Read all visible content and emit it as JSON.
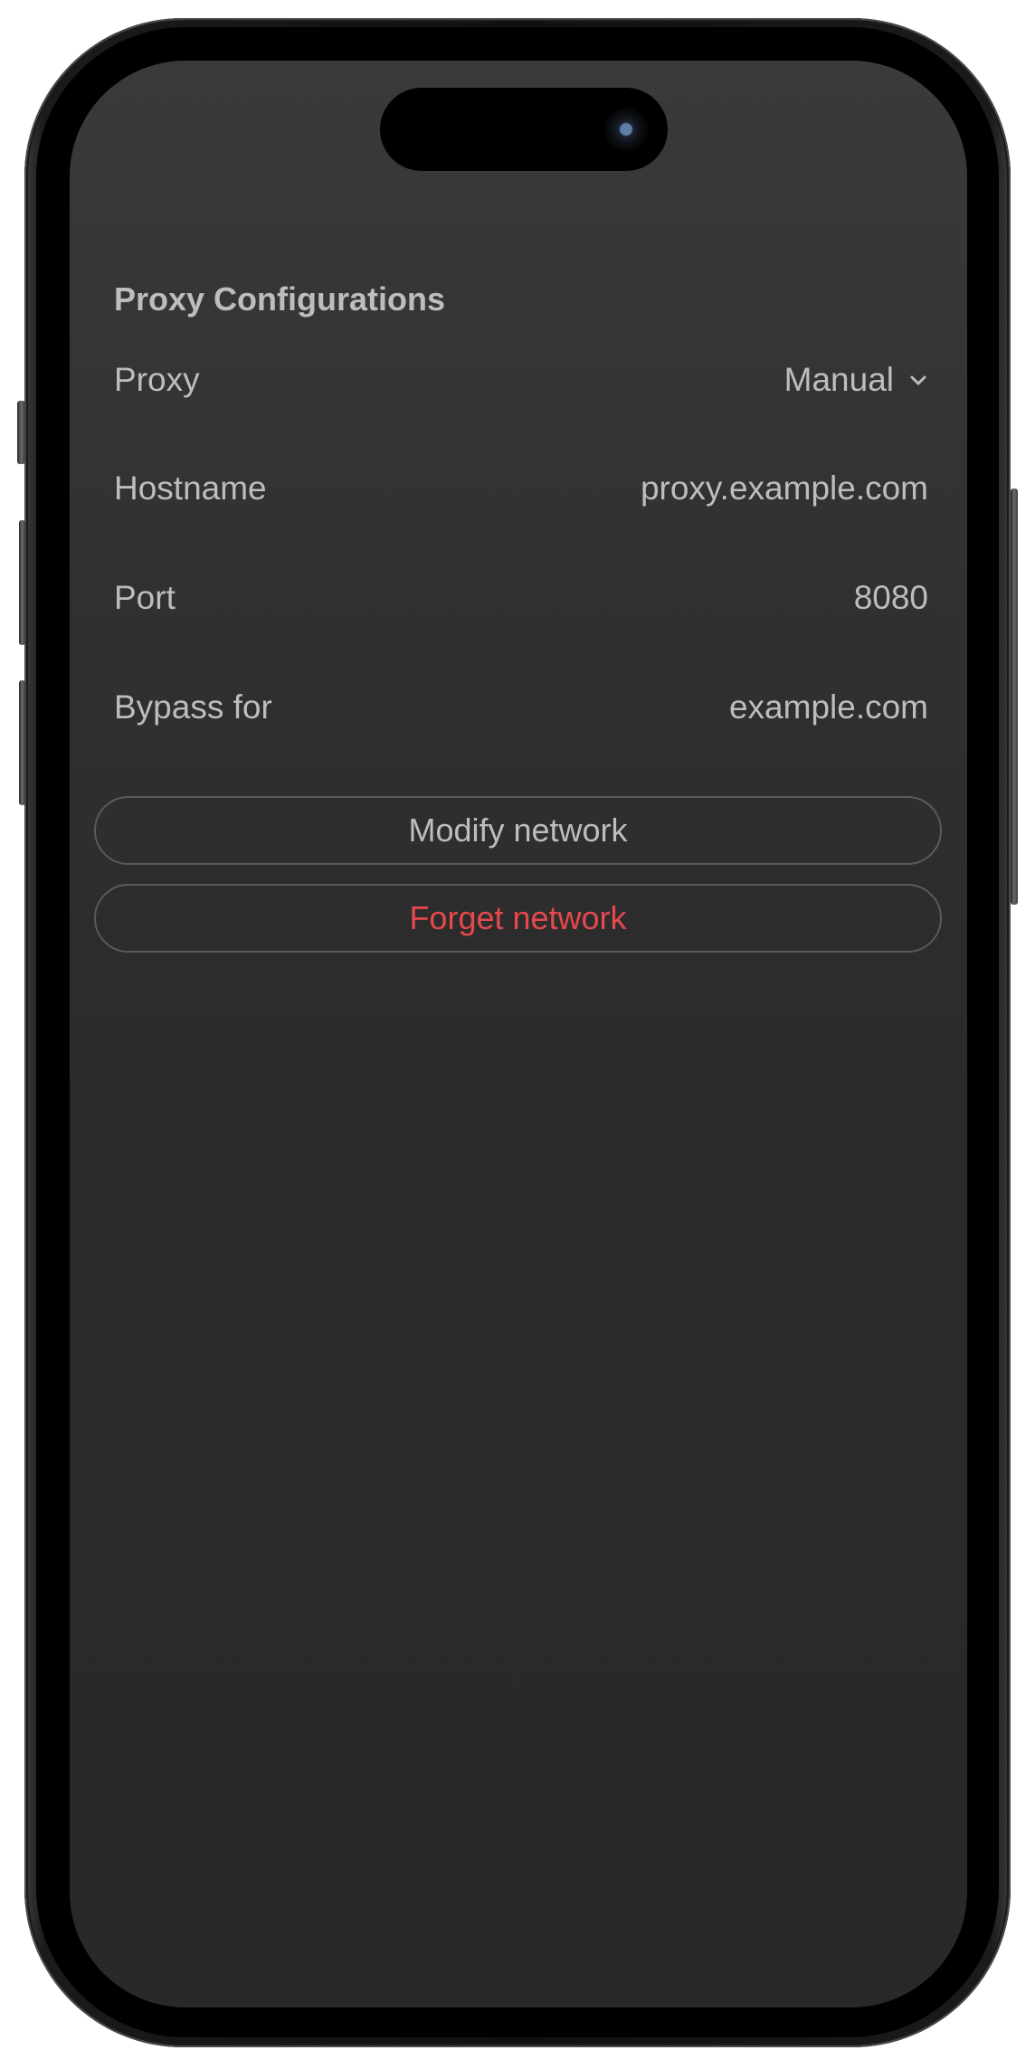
{
  "section_title": "Proxy Configurations",
  "rows": [
    {
      "label": "Proxy",
      "value": "Manual",
      "type": "dropdown"
    },
    {
      "label": "Hostname",
      "value": "proxy.example.com"
    },
    {
      "label": "Port",
      "value": "8080"
    },
    {
      "label": "Bypass for",
      "value": "example.com"
    }
  ],
  "buttons": {
    "modify": "Modify network",
    "forget": "Forget network"
  },
  "colors": {
    "text": "#bdbdbd",
    "danger": "#e5484d",
    "background": "#2a2a2a"
  }
}
